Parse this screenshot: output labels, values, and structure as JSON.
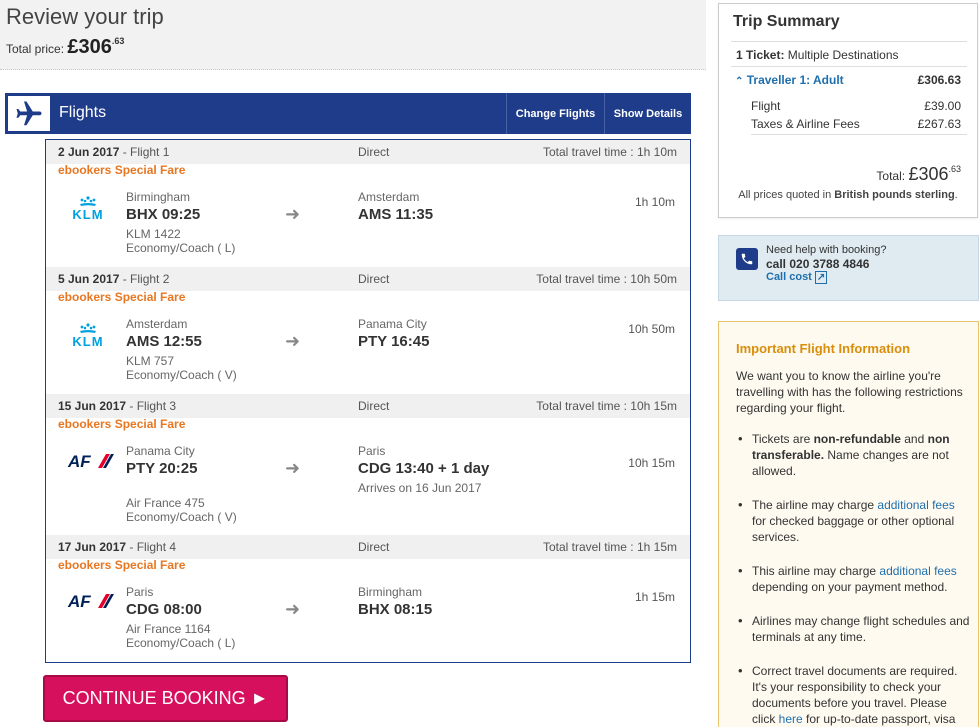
{
  "header": {
    "title": "Review your trip",
    "total_label": "Total price:",
    "total_amount": "£306",
    "total_pence": ".63"
  },
  "flights_bar": {
    "title": "Flights",
    "change_label": "Change Flights",
    "details_label": "Show Details"
  },
  "segments": [
    {
      "date": "2 Jun 2017",
      "flight": " - Flight 1",
      "stops": "Direct",
      "total_time": "Total travel time : 1h 10m",
      "fare": "ebookers Special Fare",
      "airline_logo": "KLM",
      "dep_city": "Birmingham",
      "dep_code_time": "BHX 09:25",
      "flight_no": "KLM 1422",
      "cabin": "Economy/Coach ( L)",
      "arr_city": "Amsterdam",
      "arr_code_time": "AMS 11:35",
      "arr_note": "",
      "duration": "1h 10m"
    },
    {
      "date": "5 Jun 2017",
      "flight": " - Flight 2",
      "stops": "Direct",
      "total_time": "Total travel time : 10h 50m",
      "fare": "ebookers Special Fare",
      "airline_logo": "KLM",
      "dep_city": "Amsterdam",
      "dep_code_time": "AMS 12:55",
      "flight_no": "KLM 757",
      "cabin": "Economy/Coach ( V)",
      "arr_city": "Panama City",
      "arr_code_time": "PTY 16:45",
      "arr_note": "",
      "duration": "10h 50m"
    },
    {
      "date": "15 Jun 2017",
      "flight": " - Flight 3",
      "stops": "Direct",
      "total_time": "Total travel time : 10h 15m",
      "fare": "ebookers Special Fare",
      "airline_logo": "AF",
      "dep_city": "Panama City",
      "dep_code_time": "PTY 20:25",
      "flight_no": "Air France 475",
      "cabin": "Economy/Coach ( V)",
      "arr_city": "Paris",
      "arr_code_time": "CDG 13:40 + 1 day",
      "arr_note": "Arrives on 16 Jun 2017",
      "duration": "10h 15m"
    },
    {
      "date": "17 Jun 2017",
      "flight": " - Flight 4",
      "stops": "Direct",
      "total_time": "Total travel time : 1h 15m",
      "fare": "ebookers Special Fare",
      "airline_logo": "AF",
      "dep_city": "Paris",
      "dep_code_time": "CDG 08:00",
      "flight_no": "Air France 1164",
      "cabin": "Economy/Coach ( L)",
      "arr_city": "Birmingham",
      "arr_code_time": "BHX 08:15",
      "arr_note": "",
      "duration": "1h 15m"
    }
  ],
  "continue_label": "CONTINUE BOOKING ►",
  "summary": {
    "title": "Trip Summary",
    "tickets_bold": "1 Ticket:",
    "tickets_rest": " Multiple Destinations",
    "traveller": "Traveller 1: Adult",
    "traveller_amount": "£306.63",
    "flight_label": "Flight",
    "flight_amount": "£39.00",
    "taxes_label": "Taxes & Airline Fees",
    "taxes_amount": "£267.63",
    "total_label": "Total: ",
    "total_amount": "£306",
    "total_pence": ".63",
    "note_pre": "All prices quoted in ",
    "note_bold": "British pounds sterling",
    "note_post": "."
  },
  "help": {
    "line1": "Need help with booking?",
    "line2": "call 020 3788 4846",
    "line3": "Call cost"
  },
  "info": {
    "title": "Important Flight Information",
    "intro": "We want you to know the airline you're travelling with has the following restrictions regarding your flight.",
    "b1_a": "Tickets are ",
    "b1_b": "non-refundable",
    "b1_c": " and ",
    "b1_d": "non transferable.",
    "b1_e": " Name changes are not allowed.",
    "b2_a": "The airline may charge ",
    "b2_link": "additional fees",
    "b2_b": " for checked baggage or other optional services.",
    "b3_a": "This airline may charge ",
    "b3_link": "additional fees",
    "b3_b": " depending on your payment method.",
    "b4": "Airlines may change flight schedules and terminals at any time.",
    "b5_a": "Correct travel documents are required. It's your responsibility to check your documents before you travel. Please click ",
    "b5_link": "here",
    "b5_b": " for up-to-date passport, visa"
  },
  "colors": {
    "brand_blue": "#1f3c8a",
    "fare_orange": "#e87722",
    "continue_pink": "#d6105d",
    "info_title": "#d98e0b",
    "link_blue": "#1f6fad"
  }
}
